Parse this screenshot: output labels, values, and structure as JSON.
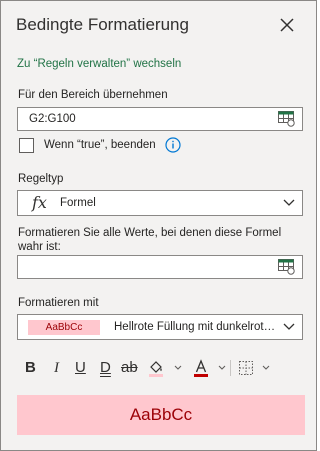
{
  "header": {
    "title": "Bedingte Formatierung"
  },
  "manage_link": "Zu “Regeln verwalten” wechseln",
  "range": {
    "label": "Für den Bereich übernehmen",
    "value": "G2:G100"
  },
  "stop_if_true": {
    "label": "Wenn “true”, beenden",
    "checked": false
  },
  "rule_type": {
    "label": "Regeltyp",
    "value": "Formel"
  },
  "formula": {
    "label": "Formatieren Sie alle Werte, bei denen diese Formel wahr ist:",
    "value": ""
  },
  "format_with": {
    "label": "Formatieren mit",
    "sample": "AaBbCc",
    "value": "Hellrote Füllung mit dunkelrot…"
  },
  "toolbar": {
    "bold": "B",
    "italic": "I",
    "underline": "U",
    "double_underline": "D",
    "strikethrough": "ab",
    "fill_color": "#ffc7ce",
    "font_color": "#c00000"
  },
  "preview": {
    "text": "AaBbCc"
  },
  "colors": {
    "accent": "#217346",
    "preview_fill": "#ffc7ce",
    "preview_text": "#9c0006"
  }
}
